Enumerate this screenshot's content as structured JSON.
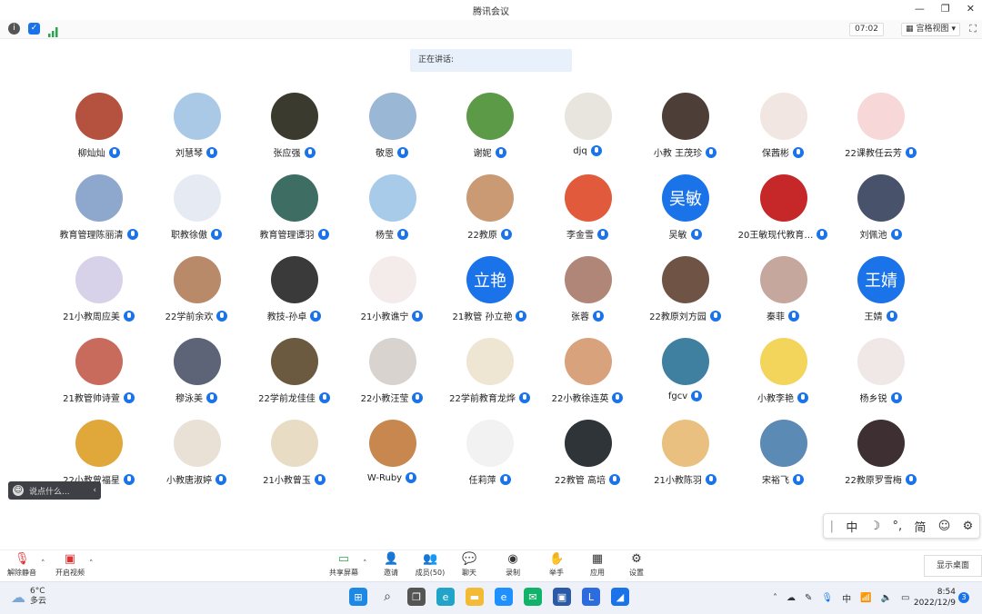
{
  "window": {
    "title": "腾讯会议",
    "min": "—",
    "restore": "❐",
    "close": "✕"
  },
  "toolbar": {
    "timer": "07:02",
    "view": "宫格视图",
    "view_arrow": "▾"
  },
  "speaking": {
    "label": "正在讲话:"
  },
  "participants": [
    {
      "name": "柳灿灿",
      "color": "#b5523f"
    },
    {
      "name": "刘慧琴",
      "color": "#a9c9e6"
    },
    {
      "name": "张应强",
      "color": "#3b3a2f"
    },
    {
      "name": "敬恩",
      "color": "#9ab7d6"
    },
    {
      "name": "谢妮",
      "color": "#5c9a48"
    },
    {
      "name": "djq",
      "color": "#e8e4de"
    },
    {
      "name": "小教 王茂珍",
      "color": "#4d3f37"
    },
    {
      "name": "保茜彬",
      "color": "#f2e6e2"
    },
    {
      "name": "22课教任云芳",
      "color": "#f7d7d7"
    },
    {
      "name": "教育管理陈丽清",
      "color": "#8ea7cc"
    },
    {
      "name": "职教徐傲",
      "color": "#e6ebf3"
    },
    {
      "name": "教育管理谭羽",
      "color": "#3e6d63"
    },
    {
      "name": "杨莹",
      "color": "#a7cbe9"
    },
    {
      "name": "22教原",
      "color": "#c99a73"
    },
    {
      "name": "李金雪",
      "color": "#e15a3b"
    },
    {
      "name": "吴敏",
      "avatar_text": "吴敏",
      "color": "#1a73e8"
    },
    {
      "name": "20王敏现代教育…",
      "color": "#c6282a"
    },
    {
      "name": "刘佩池",
      "color": "#48536b"
    },
    {
      "name": "21小教周应美",
      "color": "#d7d2ea"
    },
    {
      "name": "22学前余欢",
      "color": "#b88a6a"
    },
    {
      "name": "教技-孙卓",
      "color": "#3a3a3a"
    },
    {
      "name": "21小教谯宁",
      "color": "#f3ecea"
    },
    {
      "name": "21教管 孙立艳",
      "avatar_text": "立艳",
      "color": "#1a73e8"
    },
    {
      "name": "张蓉",
      "color": "#b08678"
    },
    {
      "name": "22教原刘方园",
      "color": "#6f5445"
    },
    {
      "name": "秦菲",
      "color": "#c6a79e"
    },
    {
      "name": "王婧",
      "avatar_text": "王婧",
      "color": "#1a73e8"
    },
    {
      "name": "21教管帅诗萱",
      "color": "#c86b5c"
    },
    {
      "name": "穆泳美",
      "color": "#5d6478"
    },
    {
      "name": "22学前龙佳佳",
      "color": "#6b5a3f"
    },
    {
      "name": "22小教汪莹",
      "color": "#d8d3cf"
    },
    {
      "name": "22学前教育龙烨",
      "color": "#efe5d3"
    },
    {
      "name": "22小教徐连英",
      "color": "#d7a27c"
    },
    {
      "name": "fgcv",
      "color": "#3f7fa0"
    },
    {
      "name": "小教李艳",
      "color": "#f3d55b"
    },
    {
      "name": "杨乡锐",
      "color": "#f0e8e6"
    },
    {
      "name": "22小教曾福星",
      "color": "#e0a73a"
    },
    {
      "name": "小教唐淑婷",
      "color": "#e9e1d6"
    },
    {
      "name": "21小教曾玉",
      "color": "#e8dcc5"
    },
    {
      "name": "W-Ruby",
      "color": "#c8874e"
    },
    {
      "name": "任莉萍",
      "color": "#f2f2f2"
    },
    {
      "name": "22教管 高培",
      "color": "#2f3439"
    },
    {
      "name": "21小教陈羽",
      "color": "#e9c07f"
    },
    {
      "name": "宋裕飞",
      "color": "#5b8ab5"
    },
    {
      "name": "22教原罗雪梅",
      "color": "#3d2f32"
    }
  ],
  "chat": {
    "placeholder": "说点什么...",
    "arrow": "‹"
  },
  "ime": [
    "中",
    "☽",
    "°,",
    "简",
    "☺",
    "⚙"
  ],
  "controls": {
    "unmute": "解除静音",
    "video": "开启视频",
    "share": "共享屏幕",
    "invite": "邀请",
    "members": "成员(50)",
    "chat": "聊天",
    "record": "录制",
    "raise": "举手",
    "apps": "应用",
    "settings": "设置",
    "show_desktop": "显示桌面"
  },
  "taskbar": {
    "temp": "6°C",
    "weather": "多云",
    "time": "8:54",
    "date": "2022/12/9",
    "notif": "3",
    "ime": "中"
  },
  "colors": {
    "accent": "#1a73e8"
  }
}
